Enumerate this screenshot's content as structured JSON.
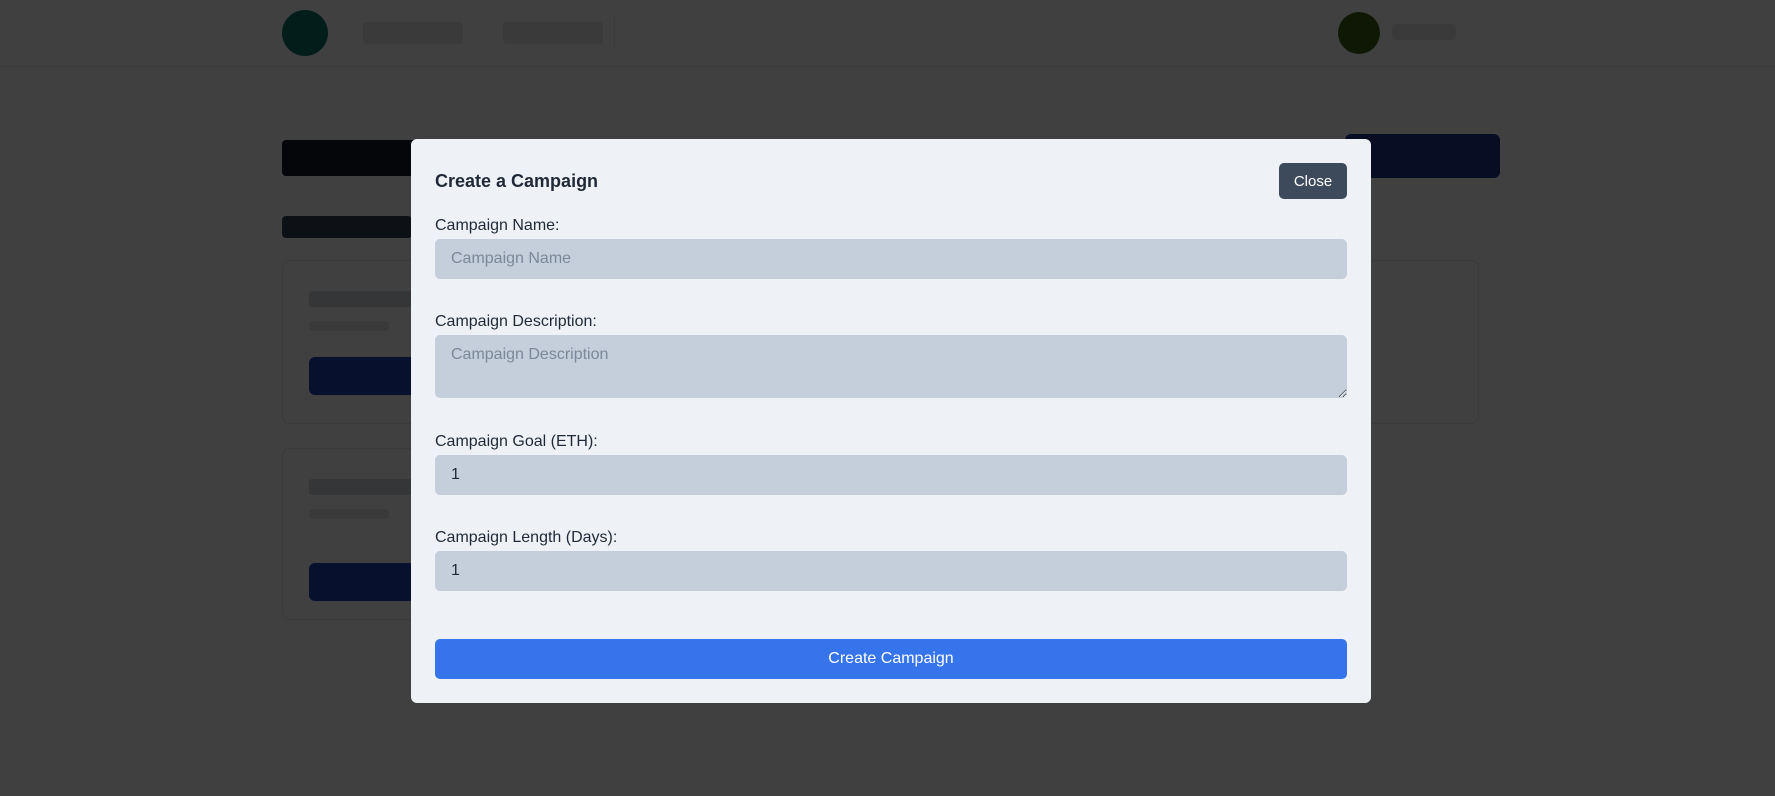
{
  "modal": {
    "title": "Create a Campaign",
    "close_label": "Close",
    "fields": {
      "name": {
        "label": "Campaign Name:",
        "placeholder": "Campaign Name",
        "value": ""
      },
      "description": {
        "label": "Campaign Description:",
        "placeholder": "Campaign Description",
        "value": ""
      },
      "goal": {
        "label": "Campaign Goal (ETH):",
        "value": "1"
      },
      "length": {
        "label": "Campaign Length (Days):",
        "value": "1"
      }
    },
    "submit_label": "Create Campaign"
  },
  "colors": {
    "overlay": "#000000",
    "modal_background": "#eef2f7",
    "input_background": "#c4cfdb",
    "close_button": "#3d4a5c",
    "primary_button": "#3674eb"
  }
}
